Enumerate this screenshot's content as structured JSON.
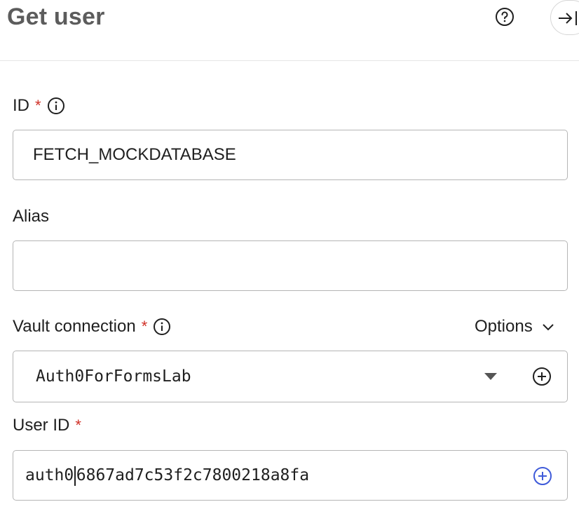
{
  "header": {
    "title": "Get user",
    "help_icon": "help-circle-icon",
    "collapse_icon": "collapse-panel-right-icon"
  },
  "fields": {
    "id": {
      "label": "ID",
      "required_mark": "*",
      "value": "FETCH_MOCKDATABASE"
    },
    "alias": {
      "label": "Alias",
      "value": ""
    },
    "vault_connection": {
      "label": "Vault connection",
      "required_mark": "*",
      "selected": "Auth0ForFormsLab",
      "options_label": "Options"
    },
    "user_id": {
      "label": "User ID",
      "required_mark": "*",
      "value_prefix": "auth0",
      "value_suffix": "6867ad7c53f2c7800218a8fa"
    }
  },
  "colors": {
    "required": "#d03027",
    "accent_plus": "#3f5bd9",
    "title": "#5c5c5c",
    "border": "#b5b5b5"
  }
}
